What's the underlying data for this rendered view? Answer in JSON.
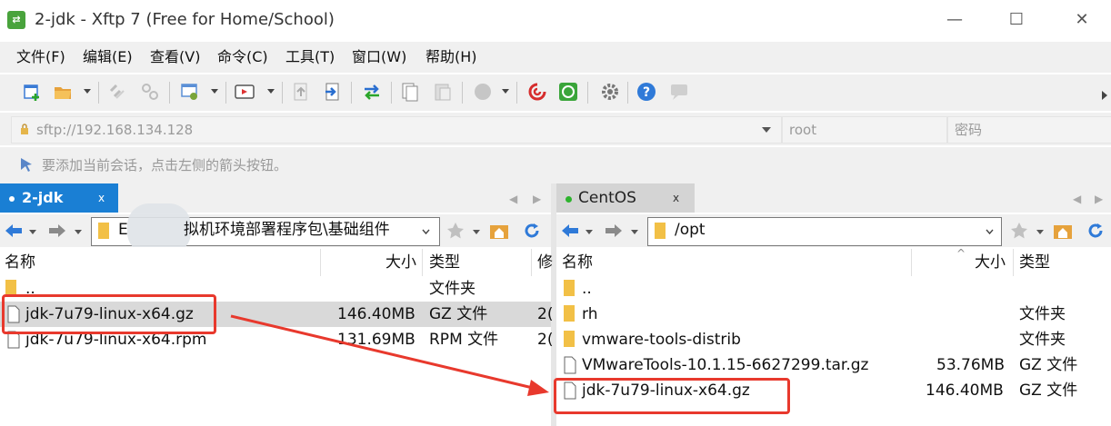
{
  "window": {
    "title": "2-jdk - Xftp 7 (Free for Home/School)",
    "app_icon": "xftp-icon",
    "controls": [
      "minimize-icon",
      "maximize-icon",
      "close-icon"
    ]
  },
  "menu": [
    "文件(F)",
    "编辑(E)",
    "查看(V)",
    "命令(C)",
    "工具(T)",
    "窗口(W)",
    "帮助(H)"
  ],
  "address": {
    "host": "sftp://192.168.134.128",
    "user_placeholder": "root",
    "password_placeholder": "密码"
  },
  "hint": "要添加当前会话，点击左侧的箭头按钮。",
  "left_panel": {
    "tab": "2-jdk",
    "tab_close": "x",
    "path_prefix": "E",
    "path": "拟机环境部署程序包\\基础组件",
    "columns": {
      "name": "名称",
      "size": "大小",
      "type": "类型",
      "modified": "修"
    },
    "rows": [
      {
        "name": "..",
        "size": "",
        "type": "文件夹",
        "modified": "",
        "kind": "folder"
      },
      {
        "name": "jdk-7u79-linux-x64.gz",
        "size": "146.40MB",
        "type": "GZ 文件",
        "modified": "2(",
        "kind": "file"
      },
      {
        "name": "jdk-7u79-linux-x64.rpm",
        "size": "131.69MB",
        "type": "RPM 文件",
        "modified": "2(",
        "kind": "file"
      }
    ]
  },
  "right_panel": {
    "tab": "CentOS",
    "tab_close": "x",
    "path": "/opt",
    "columns": {
      "name": "名称",
      "size": "大小",
      "type": "类型"
    },
    "rows": [
      {
        "name": "..",
        "size": "",
        "type": "",
        "kind": "folder"
      },
      {
        "name": "rh",
        "size": "",
        "type": "文件夹",
        "kind": "folder"
      },
      {
        "name": "vmware-tools-distrib",
        "size": "",
        "type": "文件夹",
        "kind": "folder"
      },
      {
        "name": "VMwareTools-10.1.15-6627299.tar.gz",
        "size": "53.76MB",
        "type": "GZ 文件",
        "kind": "file"
      },
      {
        "name": "jdk-7u79-linux-x64.gz",
        "size": "146.40MB",
        "type": "GZ 文件",
        "kind": "file"
      }
    ]
  },
  "annotation": {
    "color": "#e8392d",
    "arrow": "from left jdk-7u79-linux-x64.gz to right jdk-7u79-linux-x64.gz"
  },
  "colors": {
    "tab_active": "#1a7fd4",
    "highlight_row": "#d9d9d9",
    "annotation": "#e8392d"
  }
}
